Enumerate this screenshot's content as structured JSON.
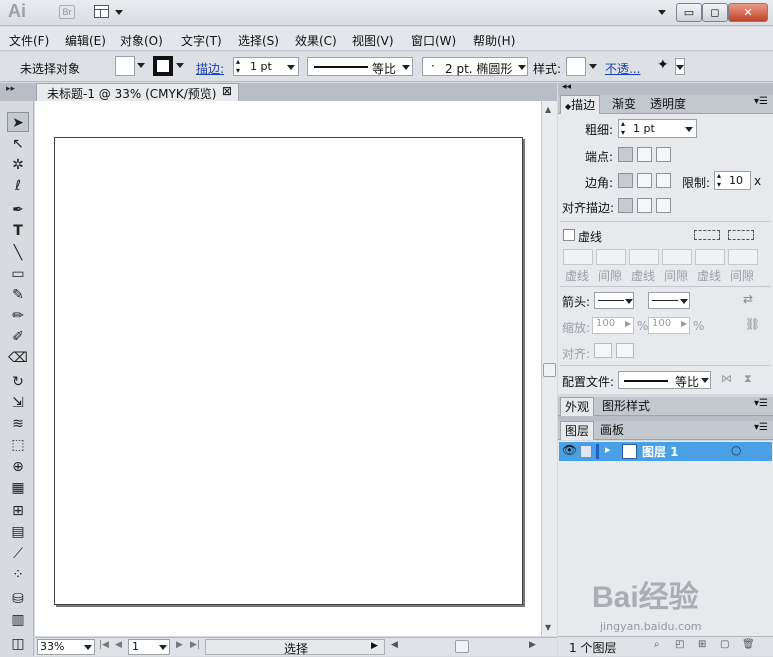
{
  "app": {
    "logo": "Ai",
    "bridge_badge": "Br"
  },
  "window_controls": {
    "minimize": "▭",
    "restore": "◻",
    "close": "✕"
  },
  "menu": [
    "文件(F)",
    "编辑(E)",
    "对象(O)",
    "文字(T)",
    "选择(S)",
    "效果(C)",
    "视图(V)",
    "窗口(W)",
    "帮助(H)"
  ],
  "control_bar": {
    "selection_status": "未选择对象",
    "stroke_label": "描边:",
    "stroke_weight": "1 pt",
    "profile_label": "等比",
    "brush_label": "2 pt. 椭圆形",
    "brush_dot": "·",
    "style_label": "样式:",
    "opacity_link": "不透..."
  },
  "document": {
    "tab_title": "未标题-1 @ 33% (CMYK/预览)",
    "tab_close": "⊠"
  },
  "toolbar": {
    "collapse": "▸▸",
    "tools": [
      "selection-tool",
      "direct-selection-tool",
      "magic-wand-tool",
      "lasso-tool",
      "pen-tool",
      "type-tool",
      "line-tool",
      "rectangle-tool",
      "paintbrush-tool",
      "pencil-tool",
      "blob-brush-tool",
      "eraser-tool",
      "rotate-tool",
      "scale-tool",
      "width-tool",
      "free-transform-tool",
      "shape-builder-tool",
      "perspective-grid-tool",
      "mesh-tool",
      "gradient-tool",
      "eyedropper-tool",
      "blend-tool",
      "symbol-sprayer-tool",
      "column-graph-tool",
      "artboard-tool"
    ]
  },
  "status_bar": {
    "zoom": "33%",
    "page": "1",
    "mode": "选择"
  },
  "stroke_panel": {
    "tabs": [
      "描边",
      "渐变",
      "透明度"
    ],
    "weight_label": "粗细:",
    "weight_value": "1 pt",
    "cap_label": "端点:",
    "corner_label": "边角:",
    "limit_label": "限制:",
    "limit_value": "10",
    "limit_unit": "x",
    "align_label": "对齐描边:",
    "dashed_label": "虚线",
    "dash_labels": [
      "虚线",
      "间隙",
      "虚线",
      "间隙",
      "虚线",
      "间隙"
    ],
    "arrow_label": "箭头:",
    "scale_label": "缩放:",
    "scale_value_1": "100",
    "scale_value_2": "100",
    "percent": "%",
    "align_arrow_label": "对齐:",
    "profile_label": "配置文件:",
    "profile_value": "等比"
  },
  "appearance_panel": {
    "tabs": [
      "外观",
      "图形样式"
    ]
  },
  "layers_panel": {
    "tabs": [
      "图层",
      "画板"
    ],
    "layer_name": "图层 1",
    "footer_count": "1 个图层"
  },
  "watermark": {
    "brand": "Bai经验",
    "url": "jingyan.baidu.com"
  },
  "colors": {
    "accent": "#4aa0e6",
    "panel_bg": "#e7e9ec",
    "link": "#1a3fb0"
  }
}
